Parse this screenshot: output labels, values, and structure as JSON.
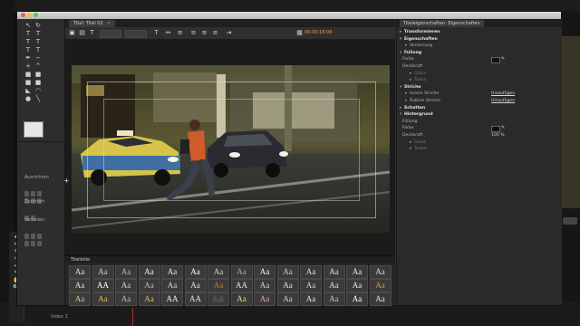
{
  "background": {
    "timeline_track_label": "Video 1"
  },
  "window": {
    "traffic_lights": [
      "close",
      "minimize",
      "zoom"
    ]
  },
  "tools_panel": {
    "align_label": "Ausrichten",
    "center_label": "Zentriert",
    "distribute_label": "Verteilen",
    "tool_icons": [
      "selection-icon",
      "rotate-icon",
      "type-icon",
      "vertical-type-icon",
      "area-type-icon",
      "vertical-area-type-icon",
      "path-type-icon",
      "vertical-path-type-icon",
      "pen-icon",
      "delete-anchor-icon",
      "add-anchor-icon",
      "convert-anchor-icon",
      "rectangle-icon",
      "clipped-rectangle-icon",
      "rounded-rectangle-icon",
      "rounded-corner-icon",
      "wedge-icon",
      "arc-icon",
      "ellipse-icon",
      "line-icon"
    ]
  },
  "editor": {
    "tab_label": "Titel: Titel 02",
    "tab_close": "≡",
    "timecode": "00:00:18:06",
    "toolbar_icons": [
      "new-title-icon",
      "roll-crawl-icon",
      "text-field-icon",
      "font-family-dropdown",
      "font-style-dropdown",
      "font-size-icon",
      "kerning-icon",
      "leading-icon",
      "align-left-icon",
      "align-center-icon",
      "align-right-icon",
      "tab-stops-icon",
      "show-background-video-icon"
    ],
    "styles_title": "Titelstile",
    "styles": [
      [
        "Aa",
        "Aa",
        "Aa",
        "Aa",
        "Aa",
        "Aa",
        "Aa",
        "Aa",
        "Aa",
        "Aa",
        "Aa",
        "Aa",
        "Aa",
        "Aa"
      ],
      [
        "Aa",
        "AA",
        "Aa",
        "Aa",
        "Aa",
        "Aa",
        "Aa",
        "AA",
        "Aa",
        "Aa",
        "Aa",
        "Aa",
        "Aa",
        "Aa"
      ],
      [
        "Aa",
        "Aa",
        "Aa",
        "Aa",
        "AA",
        "AA",
        "AA",
        "Aa",
        "Aa",
        "Aa",
        "Aa",
        "Aa",
        "Aa",
        "Aa"
      ]
    ]
  },
  "properties": {
    "tab_label": "Titeleigenschaften: Eigenschaften",
    "rows": [
      {
        "label": "Transformieren",
        "type": "hdr",
        "twisty": "▸"
      },
      {
        "label": "Eigenschaften",
        "type": "hdr",
        "twisty": "▾"
      },
      {
        "label": "Verzerrung",
        "type": "sub",
        "twisty": "▸"
      },
      {
        "label": "Füllung",
        "type": "hdr",
        "twisty": "▾"
      },
      {
        "label": "Farbe",
        "type": "item",
        "value": "swatch"
      },
      {
        "label": "Deckkraft",
        "type": "item"
      },
      {
        "label": "Glanz",
        "type": "dim",
        "twisty": "▸"
      },
      {
        "label": "Textur",
        "type": "dim",
        "twisty": "▸"
      },
      {
        "label": "Striche",
        "type": "hdr",
        "twisty": "▾"
      },
      {
        "label": "Innere Striche",
        "type": "sub",
        "twisty": "▸",
        "link": "Hinzufügen"
      },
      {
        "label": "Äußere Striche",
        "type": "sub",
        "twisty": "▸",
        "link": "Hinzufügen"
      },
      {
        "label": "Schatten",
        "type": "hdr",
        "twisty": "▸"
      },
      {
        "label": "Hintergrund",
        "type": "hdr",
        "twisty": "▾"
      },
      {
        "label": "Füllung",
        "type": "item"
      },
      {
        "label": "Farbe",
        "type": "item",
        "value": "swatch"
      },
      {
        "label": "Deckkraft",
        "type": "item",
        "text_value": "100 %"
      },
      {
        "label": "Glanz",
        "type": "dim",
        "twisty": "▸"
      },
      {
        "label": "Textur",
        "type": "dim",
        "twisty": "▸"
      }
    ]
  }
}
